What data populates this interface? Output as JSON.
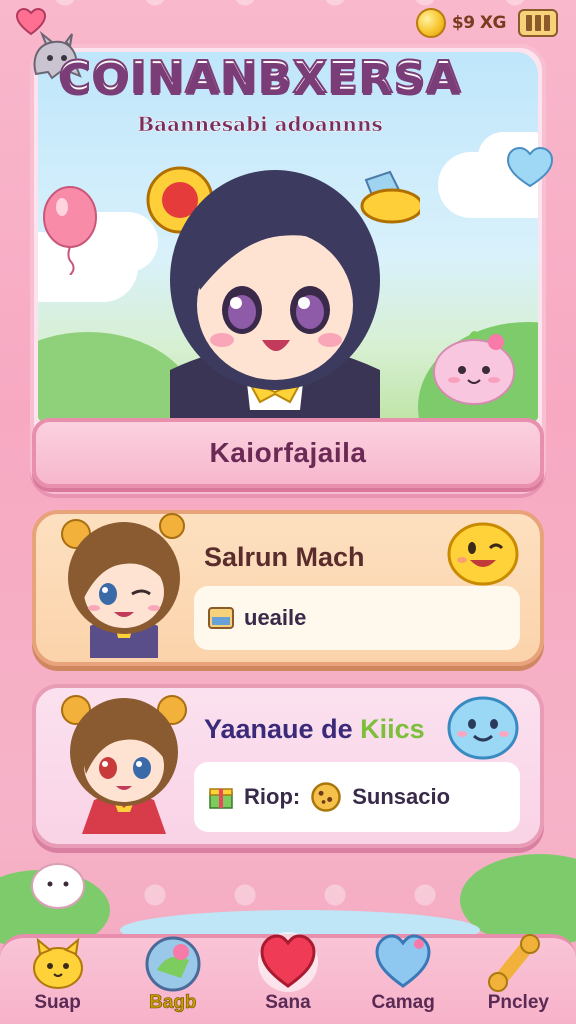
{
  "colors": {
    "background_pink": "#f7a9c2",
    "panel_border": "#e88fae",
    "title_outline": "#7a3d78",
    "card_orange": "#fbd3ab",
    "card_pink": "#f9d3e6"
  },
  "top_bar": {
    "life_icon": "heart-icon",
    "currency_icon": "coin-icon",
    "currency_text": "$9 XG",
    "menu_icon": "battery-menu-icon"
  },
  "hero": {
    "title": "COINANBXERSA",
    "subtitle": "Baannesabi adoannns",
    "avatar": "chibi-girl-avatar",
    "name_button": "Kaiorfajaila"
  },
  "cards": [
    {
      "title": "Salrun Mach",
      "avatar": "chibi-boy-winking",
      "badge_icon": "smiley-face-icon",
      "item_icon": "battery-icon",
      "item_label": "ueaile"
    },
    {
      "title_main": "Yaanaue de",
      "title_accent": "Kiics",
      "avatar": "chibi-girl-red-dress",
      "badge_icon": "blue-blob-face-icon",
      "item1_icon": "gift-box-icon",
      "item1_label": "Riop:",
      "item2_icon": "cookie-icon",
      "item2_label": "Sunsacio"
    }
  ],
  "bottom_nav": [
    {
      "label": "Suap",
      "icon": "yellow-pet-icon"
    },
    {
      "label": "Bagb",
      "icon": "orb-icon"
    },
    {
      "label": "Sana",
      "icon": "red-heart-icon"
    },
    {
      "label": "Camag",
      "icon": "blue-heart-icon"
    },
    {
      "label": "Pncley",
      "icon": "bone-icon"
    }
  ]
}
